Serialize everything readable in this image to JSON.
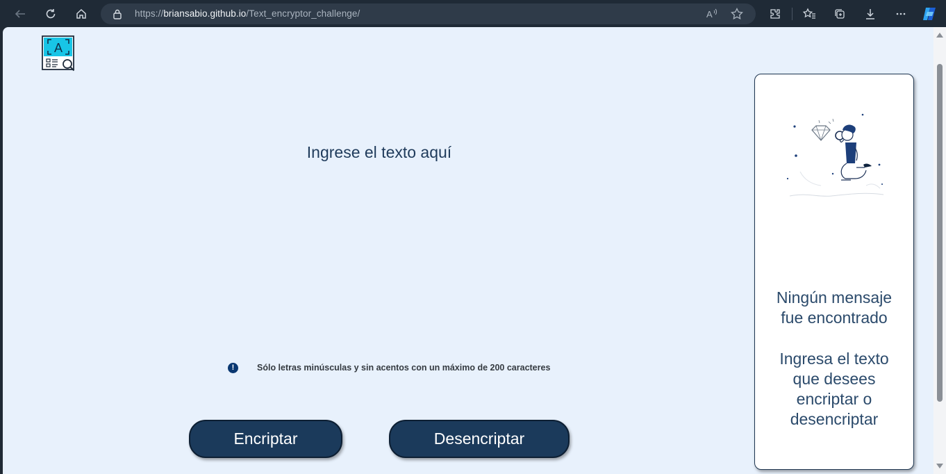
{
  "browser": {
    "url_scheme": "https://",
    "url_host": "briansabio.github.io",
    "url_path": "/Text_encryptor_challenge/"
  },
  "page": {
    "input_placeholder": "Ingrese el texto aquí",
    "hint": "Sólo letras minúsculas y sin acentos con un máximo de 200 caracteres",
    "info_glyph": "!",
    "buttons": {
      "encrypt": "Encriptar",
      "decrypt": "Desencriptar"
    }
  },
  "output_panel": {
    "no_message_lines": [
      "Ningún mensaje",
      "fue encontrado"
    ],
    "instruction_lines": [
      "Ingresa el texto",
      "que desees",
      "encriptar o",
      "desencriptar"
    ]
  },
  "colors": {
    "page_background": "#e8f1fc",
    "button_background": "#1b3a5b",
    "text_primary": "#1f3b5b",
    "info_icon": "#0a3871"
  }
}
